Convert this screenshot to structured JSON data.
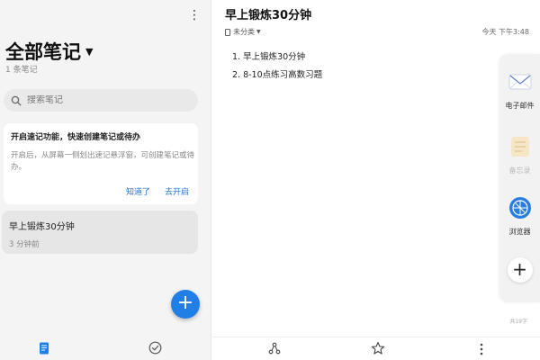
{
  "sidebar": {
    "title": "全部笔记",
    "count": "1 条笔记",
    "search_placeholder": "搜索笔记",
    "tip": {
      "title": "开启速记功能，快速创建笔记或待办",
      "body": "开启后，从屏幕一侧划出速记悬浮窗，可创建笔记或待办。",
      "dismiss_label": "知道了",
      "enable_label": "去开启"
    },
    "notes": [
      {
        "title": "早上锻炼30分钟",
        "time": "3 分钟前"
      }
    ],
    "fab_label": "+"
  },
  "editor": {
    "title": "早上锻炼30分钟",
    "category": "未分类",
    "timestamp": "今天 下午3:48",
    "lines": [
      "1. 早上锻炼30分钟",
      "2. 8-10点练习高数习题"
    ],
    "word_count": "共19字"
  },
  "side_panel": {
    "items": [
      {
        "label": "电子邮件",
        "icon": "mail-icon",
        "enabled": true
      },
      {
        "label": "备忘录",
        "icon": "memo-icon",
        "enabled": false
      },
      {
        "label": "浏览器",
        "icon": "browser-icon",
        "enabled": true
      }
    ],
    "add_label": "+"
  },
  "colors": {
    "accent": "#1f7fe6",
    "link": "#2176d6"
  }
}
